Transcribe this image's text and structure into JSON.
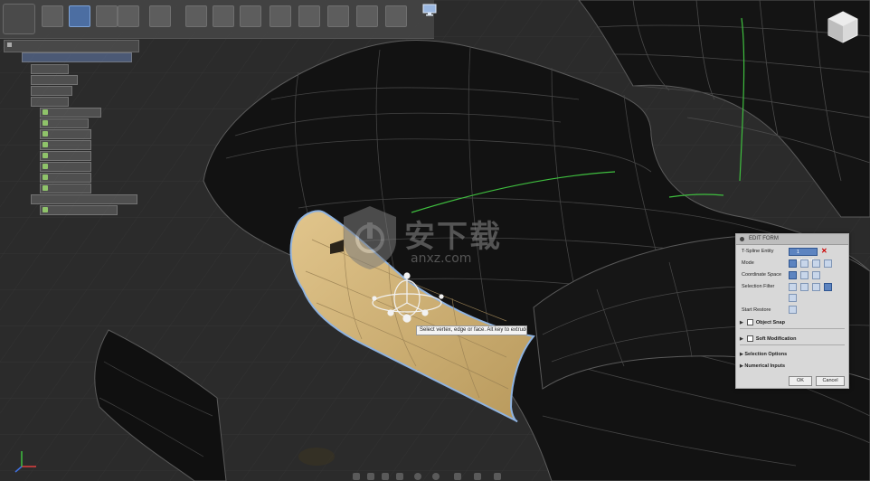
{
  "dialog": {
    "title": "EDIT FORM",
    "tspline_entity_label": "T-Spline Entity",
    "tspline_entity_value": "1 selected",
    "mode_label": "Mode",
    "coordinate_space_label": "Coordinate Space",
    "selection_filter_label": "Selection Filter",
    "start_restore_label": "Start Restore",
    "object_snap_label": "Object Snap",
    "soft_modification_label": "Soft Modification",
    "selection_options_label": "Selection Options",
    "numerical_inputs_label": "Numerical Inputs",
    "ok_label": "OK",
    "cancel_label": "Cancel"
  },
  "tooltip": {
    "text": "Select vertex, edge or face. Alt key to extrude"
  },
  "watermark": {
    "chinese": "安下载",
    "latin": "anxz.com"
  },
  "colors": {
    "viewport_bg": "#2b2b2b",
    "selected_face": "#cdb27a",
    "selection_outline": "#8fb3e0",
    "edge_highlight": "#3fbf3f",
    "dialog_bg": "#d8d8d8"
  },
  "icons": {
    "monitor": "monitor-icon",
    "viewcube": "viewcube-icon",
    "triad": "axis-triad-icon",
    "close": "close-icon"
  }
}
